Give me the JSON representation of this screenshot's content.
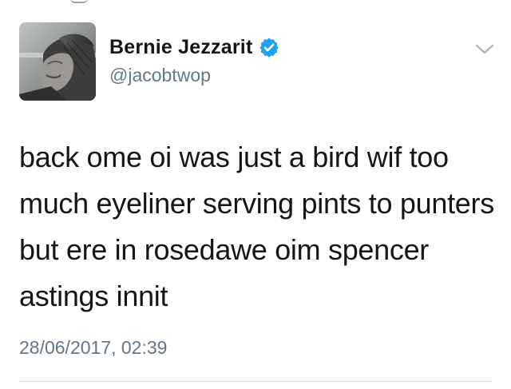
{
  "tweet": {
    "author": {
      "display_name": "Bernie Jezzarit",
      "handle": "@jacobtwop",
      "verified": true,
      "avatar_icon": "profile-photo"
    },
    "text": "back ome oi was just a bird wif too much eyeliner serving pints to punters but ere in rosedawe oim spencer astings innit",
    "timestamp": "28/06/2017, 02:39",
    "menu_icon": "chevron-down-icon"
  },
  "colors": {
    "verified_blue": "#1da1f2",
    "secondary_text": "#657786",
    "primary_text": "#14171a",
    "divider": "#d8dfe4"
  }
}
